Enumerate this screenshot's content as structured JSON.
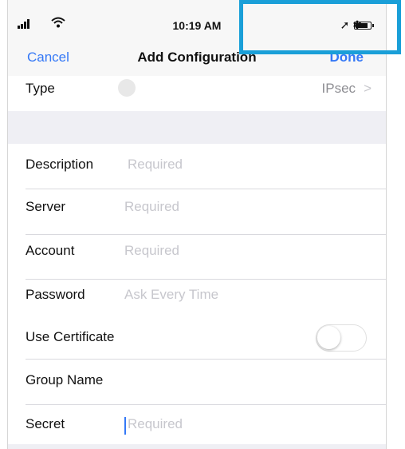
{
  "status_bar": {
    "time": "10:19 AM",
    "signal_icon": "signal-bars-icon",
    "wifi_icon": "wifi-icon",
    "location_icon": "location-arrow-icon",
    "bluetooth_icon": "bluetooth-icon",
    "battery_icon": "battery-icon"
  },
  "nav": {
    "cancel_label": "Cancel",
    "title": "Add Configuration",
    "done_label": "Done"
  },
  "type_row": {
    "label": "Type",
    "value": "IPsec",
    "chevron": ">"
  },
  "fields": [
    {
      "label": "Description",
      "placeholder": "Required"
    },
    {
      "label": "Server",
      "placeholder": "Required"
    },
    {
      "label": "Account",
      "placeholder": "Required"
    },
    {
      "label": "Password",
      "placeholder": "Ask Every Time"
    }
  ],
  "use_certificate": {
    "label": "Use Certificate",
    "on": false
  },
  "group_name": {
    "label": "Group Name"
  },
  "secret": {
    "label": "Secret",
    "placeholder": "Required"
  },
  "colors": {
    "accent": "#3478f6",
    "highlight": "#1a9fd8",
    "placeholder": "#c7c7cd"
  }
}
